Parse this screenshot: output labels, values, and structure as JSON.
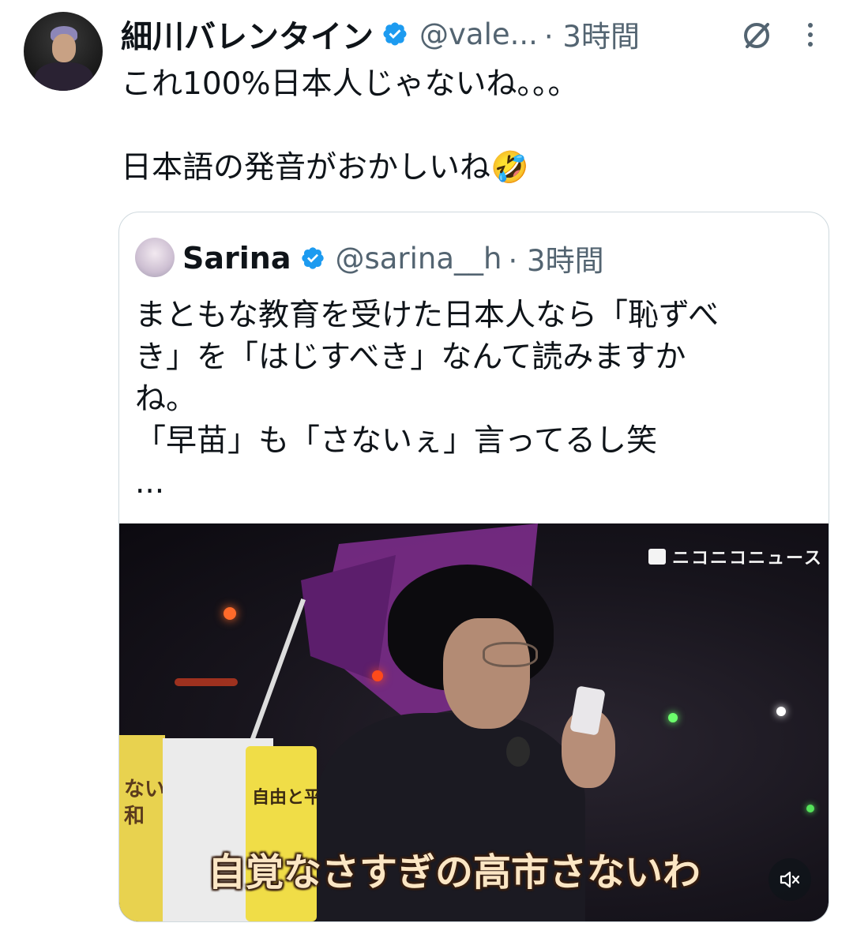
{
  "tweet": {
    "author_name": "細川バレンタイン",
    "handle": "@vale...",
    "time": "· 3時間",
    "text": "これ100%日本人じゃないね。。。\n\n日本語の発音がおかしいね🤣"
  },
  "quote": {
    "author_name": "Sarina",
    "handle": "@sarina__h",
    "time": "· 3時間",
    "text": "まともな教育を受けた日本人なら「恥ずべ\nき」を「はじすべき」なんて読みますか\nね。\n「早苗」も「さないぇ」言ってるし笑\n..."
  },
  "media": {
    "watermark": "ニコニコニュース",
    "subtitle": "自覚なさすぎの高市さないわ",
    "sign_left_text": "ない\n和",
    "sign_right_text": "自由と平和"
  },
  "icons": {
    "verified": "verified-badge-icon",
    "grok": "grok-icon",
    "more": "more-icon",
    "mute": "mute-icon"
  },
  "colors": {
    "verified_blue": "#1d9bf0",
    "secondary_text": "#536471",
    "border": "#cfd9de"
  }
}
